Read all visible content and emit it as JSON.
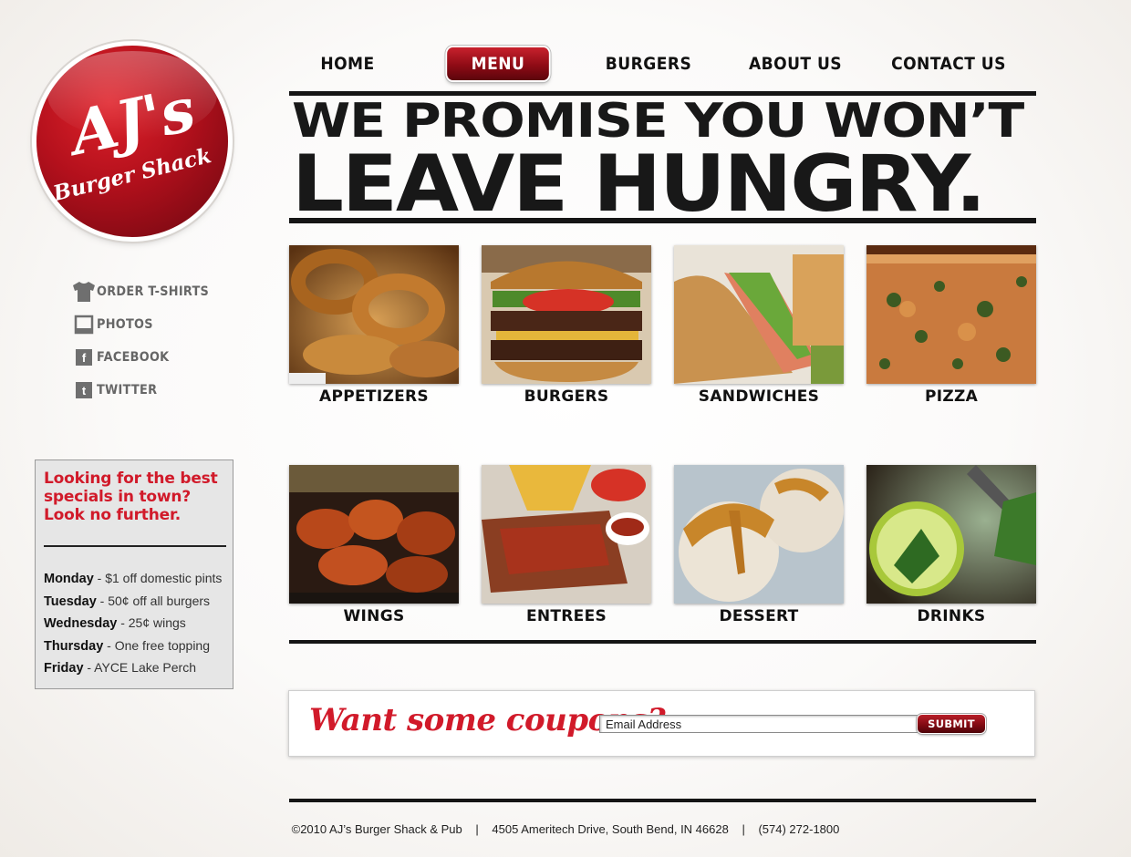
{
  "logo": {
    "line1": "AJ's",
    "line2": "Burger Shack"
  },
  "nav": {
    "items": [
      {
        "label": "HOME",
        "active": false
      },
      {
        "label": "MENU",
        "active": true
      },
      {
        "label": "BURGERS",
        "active": false
      },
      {
        "label": "ABOUT US",
        "active": false
      },
      {
        "label": "CONTACT US",
        "active": false
      }
    ]
  },
  "hero": {
    "line1": "WE PROMISE YOU WON’T",
    "line2": "LEAVE HUNGRY."
  },
  "side_links": [
    {
      "label": "ORDER T-SHIRTS",
      "icon": "tshirt-icon"
    },
    {
      "label": "PHOTOS",
      "icon": "photo-icon"
    },
    {
      "label": "FACEBOOK",
      "icon": "facebook-icon"
    },
    {
      "label": "TWITTER",
      "icon": "twitter-icon"
    }
  ],
  "specials": {
    "heading_1": "Looking for the best",
    "heading_2": "specials in town?",
    "heading_3": "Look no further.",
    "items": [
      {
        "day": "Monday",
        "deal": " - $1 off domestic pints"
      },
      {
        "day": "Tuesday",
        "deal": " - 50¢ off all burgers"
      },
      {
        "day": "Wednesday",
        "deal": " - 25¢ wings"
      },
      {
        "day": "Thursday",
        "deal": " - One free topping"
      },
      {
        "day": "Friday",
        "deal": " - AYCE Lake Perch"
      }
    ]
  },
  "menu": [
    {
      "label": "APPETIZERS"
    },
    {
      "label": "BURGERS"
    },
    {
      "label": "SANDWICHES"
    },
    {
      "label": "PIZZA"
    },
    {
      "label": "WINGS"
    },
    {
      "label": "ENTREES"
    },
    {
      "label": "DESSERT"
    },
    {
      "label": "DRINKS"
    }
  ],
  "coupons": {
    "title": "Want some coupons?",
    "email_value": "Email Address",
    "submit": "SUBMIT"
  },
  "footer": {
    "copyright": "©2010 AJ’s Burger Shack & Pub",
    "address": "4505 Ameritech Drive, South Bend, IN 46628",
    "phone": "(574) 272-1800",
    "sep": "|"
  },
  "colors": {
    "accent_red": "#d11a2a",
    "dark_red": "#8e0b15",
    "ink": "#181818"
  }
}
